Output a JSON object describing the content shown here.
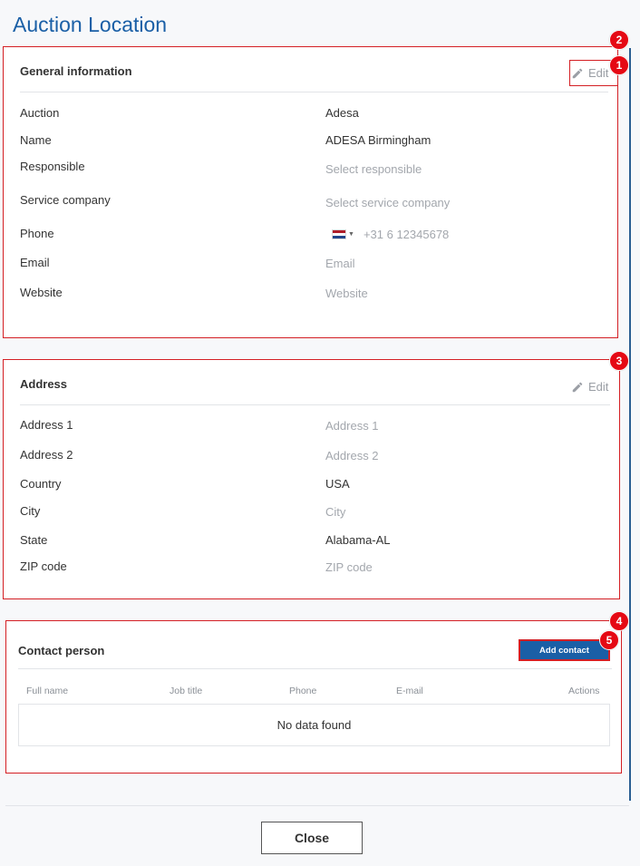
{
  "page": {
    "title": "Auction Location"
  },
  "general": {
    "title": "General information",
    "edit_label": "Edit",
    "fields": {
      "auction": {
        "label": "Auction",
        "value": "Adesa"
      },
      "name": {
        "label": "Name",
        "value": "ADESA Birmingham"
      },
      "responsible": {
        "label": "Responsible",
        "placeholder": "Select responsible"
      },
      "service_company": {
        "label": "Service company",
        "placeholder": "Select service company"
      },
      "phone": {
        "label": "Phone",
        "placeholder": "+31 6 12345678",
        "country_flag": "netherlands-flag-icon"
      },
      "email": {
        "label": "Email",
        "placeholder": "Email"
      },
      "website": {
        "label": "Website",
        "placeholder": "Website"
      }
    }
  },
  "address": {
    "title": "Address",
    "edit_label": "Edit",
    "fields": {
      "address1": {
        "label": "Address 1",
        "placeholder": "Address 1"
      },
      "address2": {
        "label": "Address 2",
        "placeholder": "Address 2"
      },
      "country": {
        "label": "Country",
        "value": "USA"
      },
      "city": {
        "label": "City",
        "placeholder": "City"
      },
      "state": {
        "label": "State",
        "value": "Alabama-AL"
      },
      "zip": {
        "label": "ZIP code",
        "placeholder": "ZIP code"
      }
    }
  },
  "contact": {
    "title": "Contact person",
    "add_label": "Add contact",
    "columns": [
      "Full name",
      "Job title",
      "Phone",
      "E-mail",
      "Actions"
    ],
    "empty_text": "No data found"
  },
  "footer": {
    "close_label": "Close"
  },
  "badges": [
    "1",
    "2",
    "3",
    "4",
    "5"
  ],
  "colors": {
    "accent": "#1a5fa6",
    "highlight": "#d41f24",
    "badge": "#e50914",
    "placeholder": "#a3a7ad"
  }
}
